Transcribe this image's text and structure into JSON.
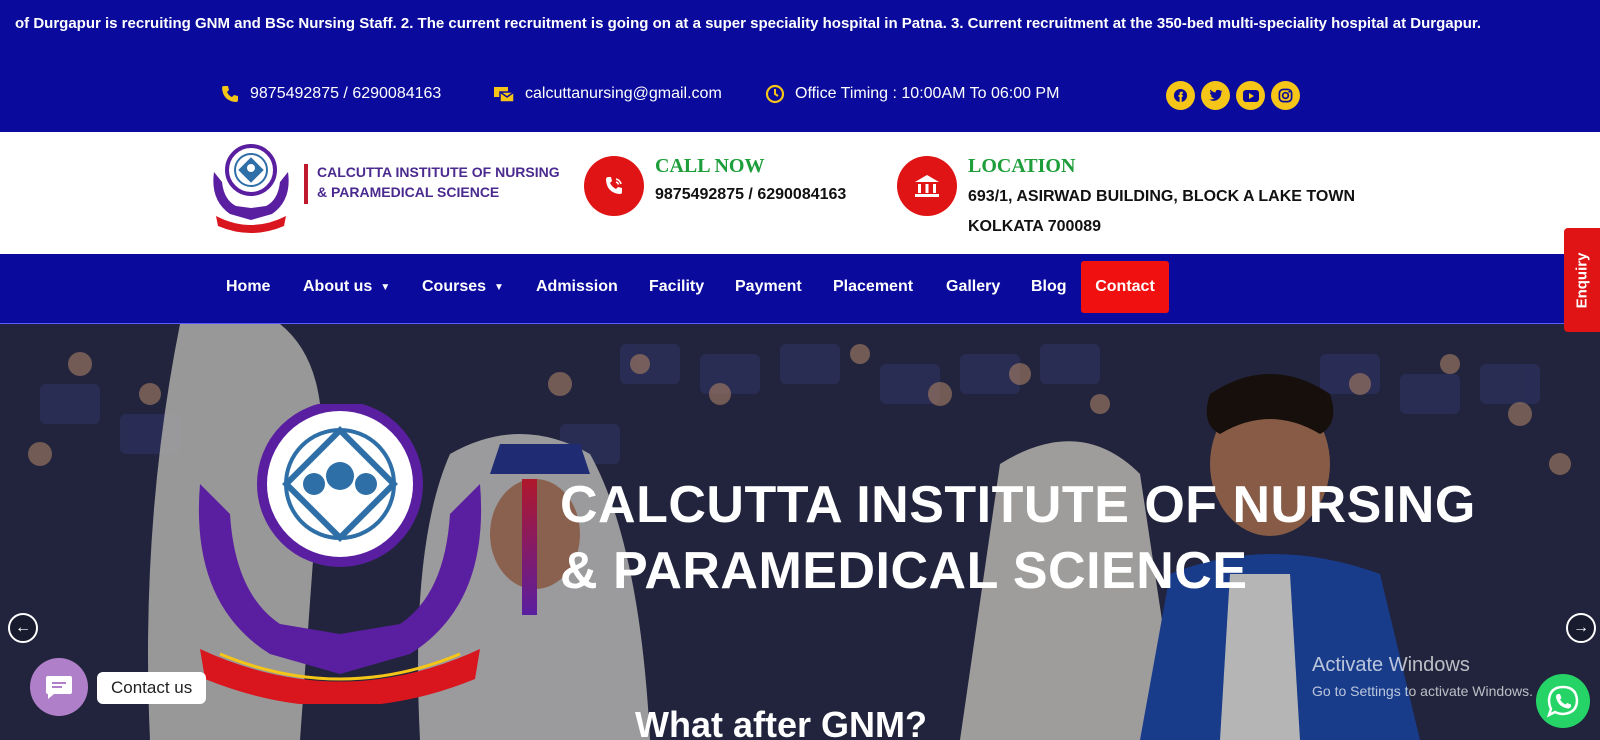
{
  "ticker": {
    "text": "of Durgapur is recruiting GNM and BSc Nursing Staff. 2. The current recruitment is going on at a super speciality hospital in Patna. 3. Current recruitment at the 350-bed multi-speciality hospital at Durgapur."
  },
  "topbar": {
    "phone": "9875492875 / 6290084163",
    "email": "calcuttanursing@gmail.com",
    "timing": "Office Timing : 10:00AM To 06:00 PM",
    "social": [
      "facebook-icon",
      "twitter-icon",
      "youtube-icon",
      "instagram-icon"
    ]
  },
  "header": {
    "logo_line1": "CALCUTTA INSTITUTE OF NURSING",
    "logo_line2": "& PARAMEDICAL SCIENCE",
    "call_title": "CALL NOW",
    "call_value": "9875492875 / 6290084163",
    "location_title": "LOCATION",
    "location_line1": "693/1, ASIRWAD BUILDING, BLOCK A LAKE TOWN",
    "location_line2": "KOLKATA 700089"
  },
  "nav": {
    "home": "Home",
    "about": "About us",
    "courses": "Courses",
    "admission": "Admission",
    "facility": "Facility",
    "payment": "Payment",
    "placement": "Placement",
    "gallery": "Gallery",
    "blog": "Blog",
    "contact": "Contact"
  },
  "hero": {
    "title_line1": "CALCUTTA INSTITUTE OF NURSING",
    "title_line2": "& PARAMEDICAL SCIENCE",
    "subtitle": "What after GNM?"
  },
  "enquiry": "Enquiry",
  "chat": {
    "label": "Contact us"
  },
  "windows": {
    "line1": "Activate Windows",
    "line2": "Go to Settings to activate Windows."
  },
  "colors": {
    "primary": "#0a0a9c",
    "accent": "#f5c518",
    "red": "#e01414",
    "green": "#1d9e3a"
  }
}
